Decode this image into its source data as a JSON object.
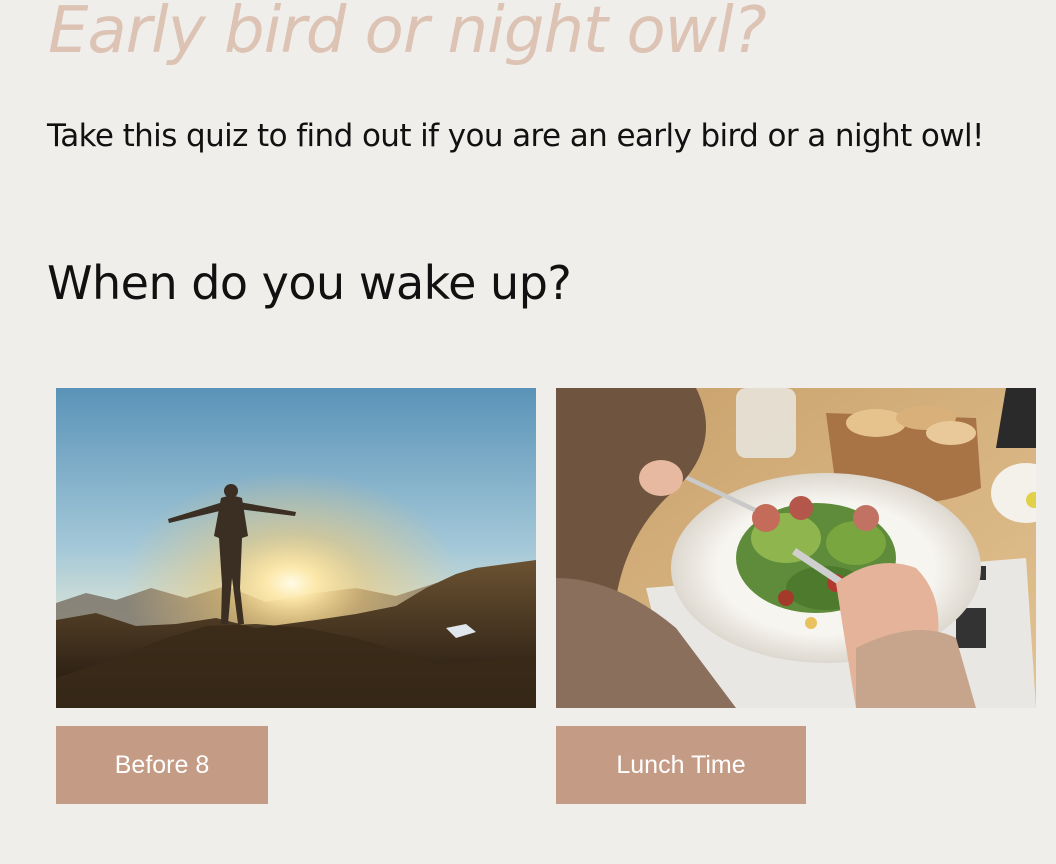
{
  "page": {
    "title": "Early bird or night owl?",
    "intro": "Take this quiz to find out if you are an early bird or a night owl!"
  },
  "quiz": {
    "question": "When do you wake up?",
    "answers": [
      {
        "label": "Before 8",
        "image": "person-arms-raised-at-sunrise-photo"
      },
      {
        "label": "Lunch Time",
        "image": "salad-plate-lunch-photo"
      }
    ]
  },
  "colors": {
    "background": "#f0eeeb",
    "title": "#dcc3b4",
    "button": "#c49b84",
    "button_text": "#ffffff"
  }
}
